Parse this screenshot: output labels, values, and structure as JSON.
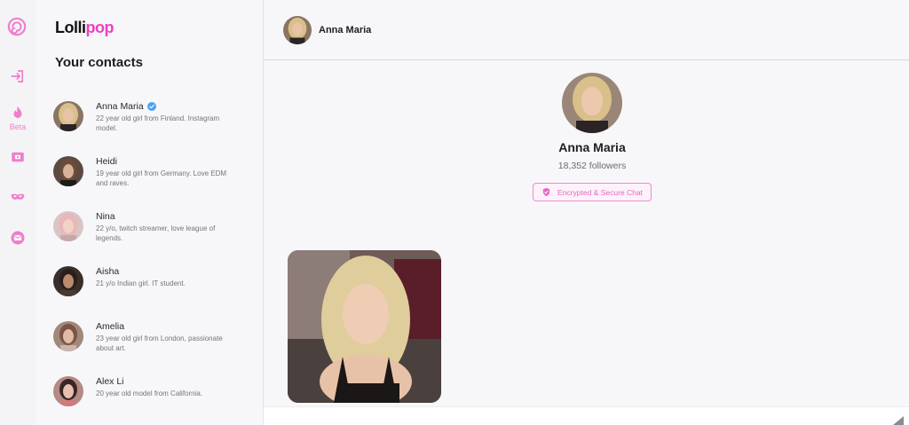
{
  "brand": {
    "part1": "Lolli",
    "part2": "pop",
    "accent": "#ee3fc0"
  },
  "rail": {
    "items": [
      {
        "icon": "lollipop-icon"
      },
      {
        "icon": "login-icon"
      },
      {
        "icon": "flame-icon",
        "label": "Beta"
      },
      {
        "icon": "wallet-icon"
      },
      {
        "icon": "mask-icon"
      },
      {
        "icon": "mail-icon"
      }
    ]
  },
  "contacts": {
    "title": "Your contacts",
    "items": [
      {
        "name": "Anna Maria",
        "verified": true,
        "desc": "22 year old girl from Finland. Instagram model."
      },
      {
        "name": "Heidi",
        "desc": "19 year old girl from Germany. Love EDM and raves."
      },
      {
        "name": "Nina",
        "desc": "22 y/o, twitch streamer, love league of legends."
      },
      {
        "name": "Aisha",
        "desc": "21 y/o Indian girl. IT student."
      },
      {
        "name": "Amelia",
        "desc": "23 year old girl from London, passionate about art."
      },
      {
        "name": "Alex Li",
        "desc": "20 year old model from California."
      }
    ]
  },
  "chat": {
    "header_name": "Anna Maria",
    "profile_name": "Anna Maria",
    "followers": "18,352 followers",
    "secure_label": "Encrypted & Secure Chat"
  }
}
